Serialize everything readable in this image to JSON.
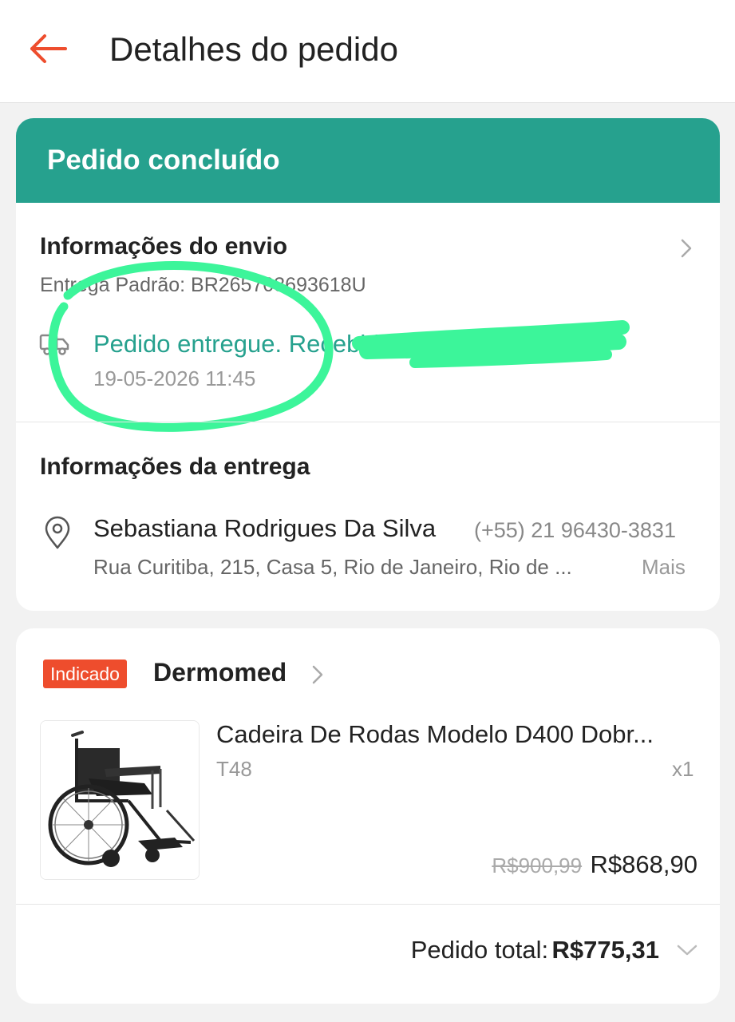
{
  "header": {
    "title": "Detalhes do pedido",
    "back_icon": "arrow-left-icon",
    "accent_color": "#ee4d2d"
  },
  "order_status": {
    "label": "Pedido concluído",
    "color": "#26a18e"
  },
  "shipping": {
    "title": "Informações do envio",
    "method": "Entrega Padrão: BR265703693618U",
    "tracking_status": "Pedido entregue. Recebido",
    "tracking_date": "19-05-2026 11:45",
    "truck_icon": "truck-icon",
    "chevron_icon": "chevron-right-icon"
  },
  "delivery": {
    "title": "Informações da entrega",
    "name": "Sebastiana Rodrigues Da Silva",
    "phone": "(+55) 21 96430-3831",
    "address": "Rua Curitiba, 215, Casa 5, Rio de Janeiro, Rio de ...",
    "more_label": "Mais",
    "pin_icon": "location-pin-icon"
  },
  "shop": {
    "badge": "Indicado",
    "name": "Dermomed",
    "badge_color": "#ee4d2d"
  },
  "product": {
    "name": "Cadeira De Rodas Modelo D400 Dobr...",
    "variation": "T48",
    "quantity": "x1",
    "original_price": "R$900,99",
    "price": "R$868,90",
    "image_icon": "wheelchair-image"
  },
  "order_total": {
    "label": "Pedido total:",
    "value": "R$775,31",
    "chevron_icon": "chevron-down-icon"
  },
  "annotation_color": "#3cf59a"
}
